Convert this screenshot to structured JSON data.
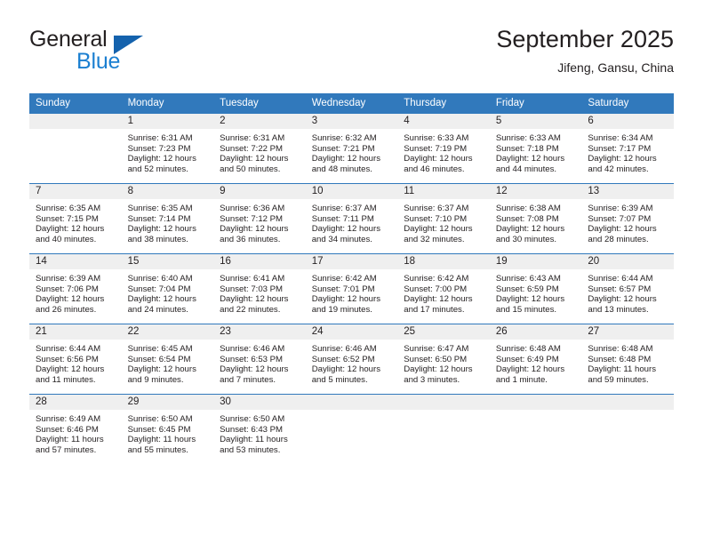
{
  "brand": {
    "name_top": "General",
    "name_bottom": "Blue",
    "logo_icon": "triangle-logo-icon"
  },
  "header": {
    "month_title": "September 2025",
    "location": "Jifeng, Gansu, China"
  },
  "calendar": {
    "weekday_headers": [
      "Sunday",
      "Monday",
      "Tuesday",
      "Wednesday",
      "Thursday",
      "Friday",
      "Saturday"
    ],
    "accent_color": "#3179bc",
    "daynum_band_color": "#efefef",
    "weeks": [
      [
        {
          "day": "",
          "lines": []
        },
        {
          "day": "1",
          "lines": [
            "Sunrise: 6:31 AM",
            "Sunset: 7:23 PM",
            "Daylight: 12 hours",
            "and 52 minutes."
          ]
        },
        {
          "day": "2",
          "lines": [
            "Sunrise: 6:31 AM",
            "Sunset: 7:22 PM",
            "Daylight: 12 hours",
            "and 50 minutes."
          ]
        },
        {
          "day": "3",
          "lines": [
            "Sunrise: 6:32 AM",
            "Sunset: 7:21 PM",
            "Daylight: 12 hours",
            "and 48 minutes."
          ]
        },
        {
          "day": "4",
          "lines": [
            "Sunrise: 6:33 AM",
            "Sunset: 7:19 PM",
            "Daylight: 12 hours",
            "and 46 minutes."
          ]
        },
        {
          "day": "5",
          "lines": [
            "Sunrise: 6:33 AM",
            "Sunset: 7:18 PM",
            "Daylight: 12 hours",
            "and 44 minutes."
          ]
        },
        {
          "day": "6",
          "lines": [
            "Sunrise: 6:34 AM",
            "Sunset: 7:17 PM",
            "Daylight: 12 hours",
            "and 42 minutes."
          ]
        }
      ],
      [
        {
          "day": "7",
          "lines": [
            "Sunrise: 6:35 AM",
            "Sunset: 7:15 PM",
            "Daylight: 12 hours",
            "and 40 minutes."
          ]
        },
        {
          "day": "8",
          "lines": [
            "Sunrise: 6:35 AM",
            "Sunset: 7:14 PM",
            "Daylight: 12 hours",
            "and 38 minutes."
          ]
        },
        {
          "day": "9",
          "lines": [
            "Sunrise: 6:36 AM",
            "Sunset: 7:12 PM",
            "Daylight: 12 hours",
            "and 36 minutes."
          ]
        },
        {
          "day": "10",
          "lines": [
            "Sunrise: 6:37 AM",
            "Sunset: 7:11 PM",
            "Daylight: 12 hours",
            "and 34 minutes."
          ]
        },
        {
          "day": "11",
          "lines": [
            "Sunrise: 6:37 AM",
            "Sunset: 7:10 PM",
            "Daylight: 12 hours",
            "and 32 minutes."
          ]
        },
        {
          "day": "12",
          "lines": [
            "Sunrise: 6:38 AM",
            "Sunset: 7:08 PM",
            "Daylight: 12 hours",
            "and 30 minutes."
          ]
        },
        {
          "day": "13",
          "lines": [
            "Sunrise: 6:39 AM",
            "Sunset: 7:07 PM",
            "Daylight: 12 hours",
            "and 28 minutes."
          ]
        }
      ],
      [
        {
          "day": "14",
          "lines": [
            "Sunrise: 6:39 AM",
            "Sunset: 7:06 PM",
            "Daylight: 12 hours",
            "and 26 minutes."
          ]
        },
        {
          "day": "15",
          "lines": [
            "Sunrise: 6:40 AM",
            "Sunset: 7:04 PM",
            "Daylight: 12 hours",
            "and 24 minutes."
          ]
        },
        {
          "day": "16",
          "lines": [
            "Sunrise: 6:41 AM",
            "Sunset: 7:03 PM",
            "Daylight: 12 hours",
            "and 22 minutes."
          ]
        },
        {
          "day": "17",
          "lines": [
            "Sunrise: 6:42 AM",
            "Sunset: 7:01 PM",
            "Daylight: 12 hours",
            "and 19 minutes."
          ]
        },
        {
          "day": "18",
          "lines": [
            "Sunrise: 6:42 AM",
            "Sunset: 7:00 PM",
            "Daylight: 12 hours",
            "and 17 minutes."
          ]
        },
        {
          "day": "19",
          "lines": [
            "Sunrise: 6:43 AM",
            "Sunset: 6:59 PM",
            "Daylight: 12 hours",
            "and 15 minutes."
          ]
        },
        {
          "day": "20",
          "lines": [
            "Sunrise: 6:44 AM",
            "Sunset: 6:57 PM",
            "Daylight: 12 hours",
            "and 13 minutes."
          ]
        }
      ],
      [
        {
          "day": "21",
          "lines": [
            "Sunrise: 6:44 AM",
            "Sunset: 6:56 PM",
            "Daylight: 12 hours",
            "and 11 minutes."
          ]
        },
        {
          "day": "22",
          "lines": [
            "Sunrise: 6:45 AM",
            "Sunset: 6:54 PM",
            "Daylight: 12 hours",
            "and 9 minutes."
          ]
        },
        {
          "day": "23",
          "lines": [
            "Sunrise: 6:46 AM",
            "Sunset: 6:53 PM",
            "Daylight: 12 hours",
            "and 7 minutes."
          ]
        },
        {
          "day": "24",
          "lines": [
            "Sunrise: 6:46 AM",
            "Sunset: 6:52 PM",
            "Daylight: 12 hours",
            "and 5 minutes."
          ]
        },
        {
          "day": "25",
          "lines": [
            "Sunrise: 6:47 AM",
            "Sunset: 6:50 PM",
            "Daylight: 12 hours",
            "and 3 minutes."
          ]
        },
        {
          "day": "26",
          "lines": [
            "Sunrise: 6:48 AM",
            "Sunset: 6:49 PM",
            "Daylight: 12 hours",
            "and 1 minute."
          ]
        },
        {
          "day": "27",
          "lines": [
            "Sunrise: 6:48 AM",
            "Sunset: 6:48 PM",
            "Daylight: 11 hours",
            "and 59 minutes."
          ]
        }
      ],
      [
        {
          "day": "28",
          "lines": [
            "Sunrise: 6:49 AM",
            "Sunset: 6:46 PM",
            "Daylight: 11 hours",
            "and 57 minutes."
          ]
        },
        {
          "day": "29",
          "lines": [
            "Sunrise: 6:50 AM",
            "Sunset: 6:45 PM",
            "Daylight: 11 hours",
            "and 55 minutes."
          ]
        },
        {
          "day": "30",
          "lines": [
            "Sunrise: 6:50 AM",
            "Sunset: 6:43 PM",
            "Daylight: 11 hours",
            "and 53 minutes."
          ]
        },
        {
          "day": "",
          "lines": []
        },
        {
          "day": "",
          "lines": []
        },
        {
          "day": "",
          "lines": []
        },
        {
          "day": "",
          "lines": []
        }
      ]
    ]
  }
}
